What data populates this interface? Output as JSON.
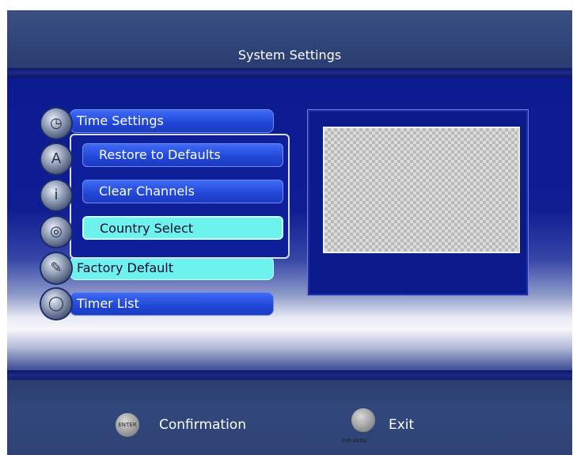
{
  "header": {
    "title": "System Settings"
  },
  "menu": {
    "items": [
      {
        "label": "Time Settings",
        "icon": "clock-icon"
      },
      {
        "label": "",
        "icon": "font-icon"
      },
      {
        "label": "",
        "icon": "info-icon"
      },
      {
        "label": "",
        "icon": "globe-icon"
      },
      {
        "label": "Factory Default",
        "icon": "tool-icon",
        "selected": true
      },
      {
        "label": "Timer List",
        "icon": "timer-icon"
      }
    ]
  },
  "submenu": {
    "items": [
      {
        "label": "Restore to Defaults"
      },
      {
        "label": "Clear Channels"
      },
      {
        "label": "Country Select",
        "selected": true
      }
    ]
  },
  "footer": {
    "confirm": {
      "button_text": "ENTER",
      "label": "Confirmation"
    },
    "exit": {
      "button_sublabel": "PVR MENU",
      "label": "Exit"
    }
  },
  "colors": {
    "menu_item": "#2146d6",
    "selected": "#6ef2ee",
    "background": "#0f1d93",
    "header": "#2f4478"
  }
}
